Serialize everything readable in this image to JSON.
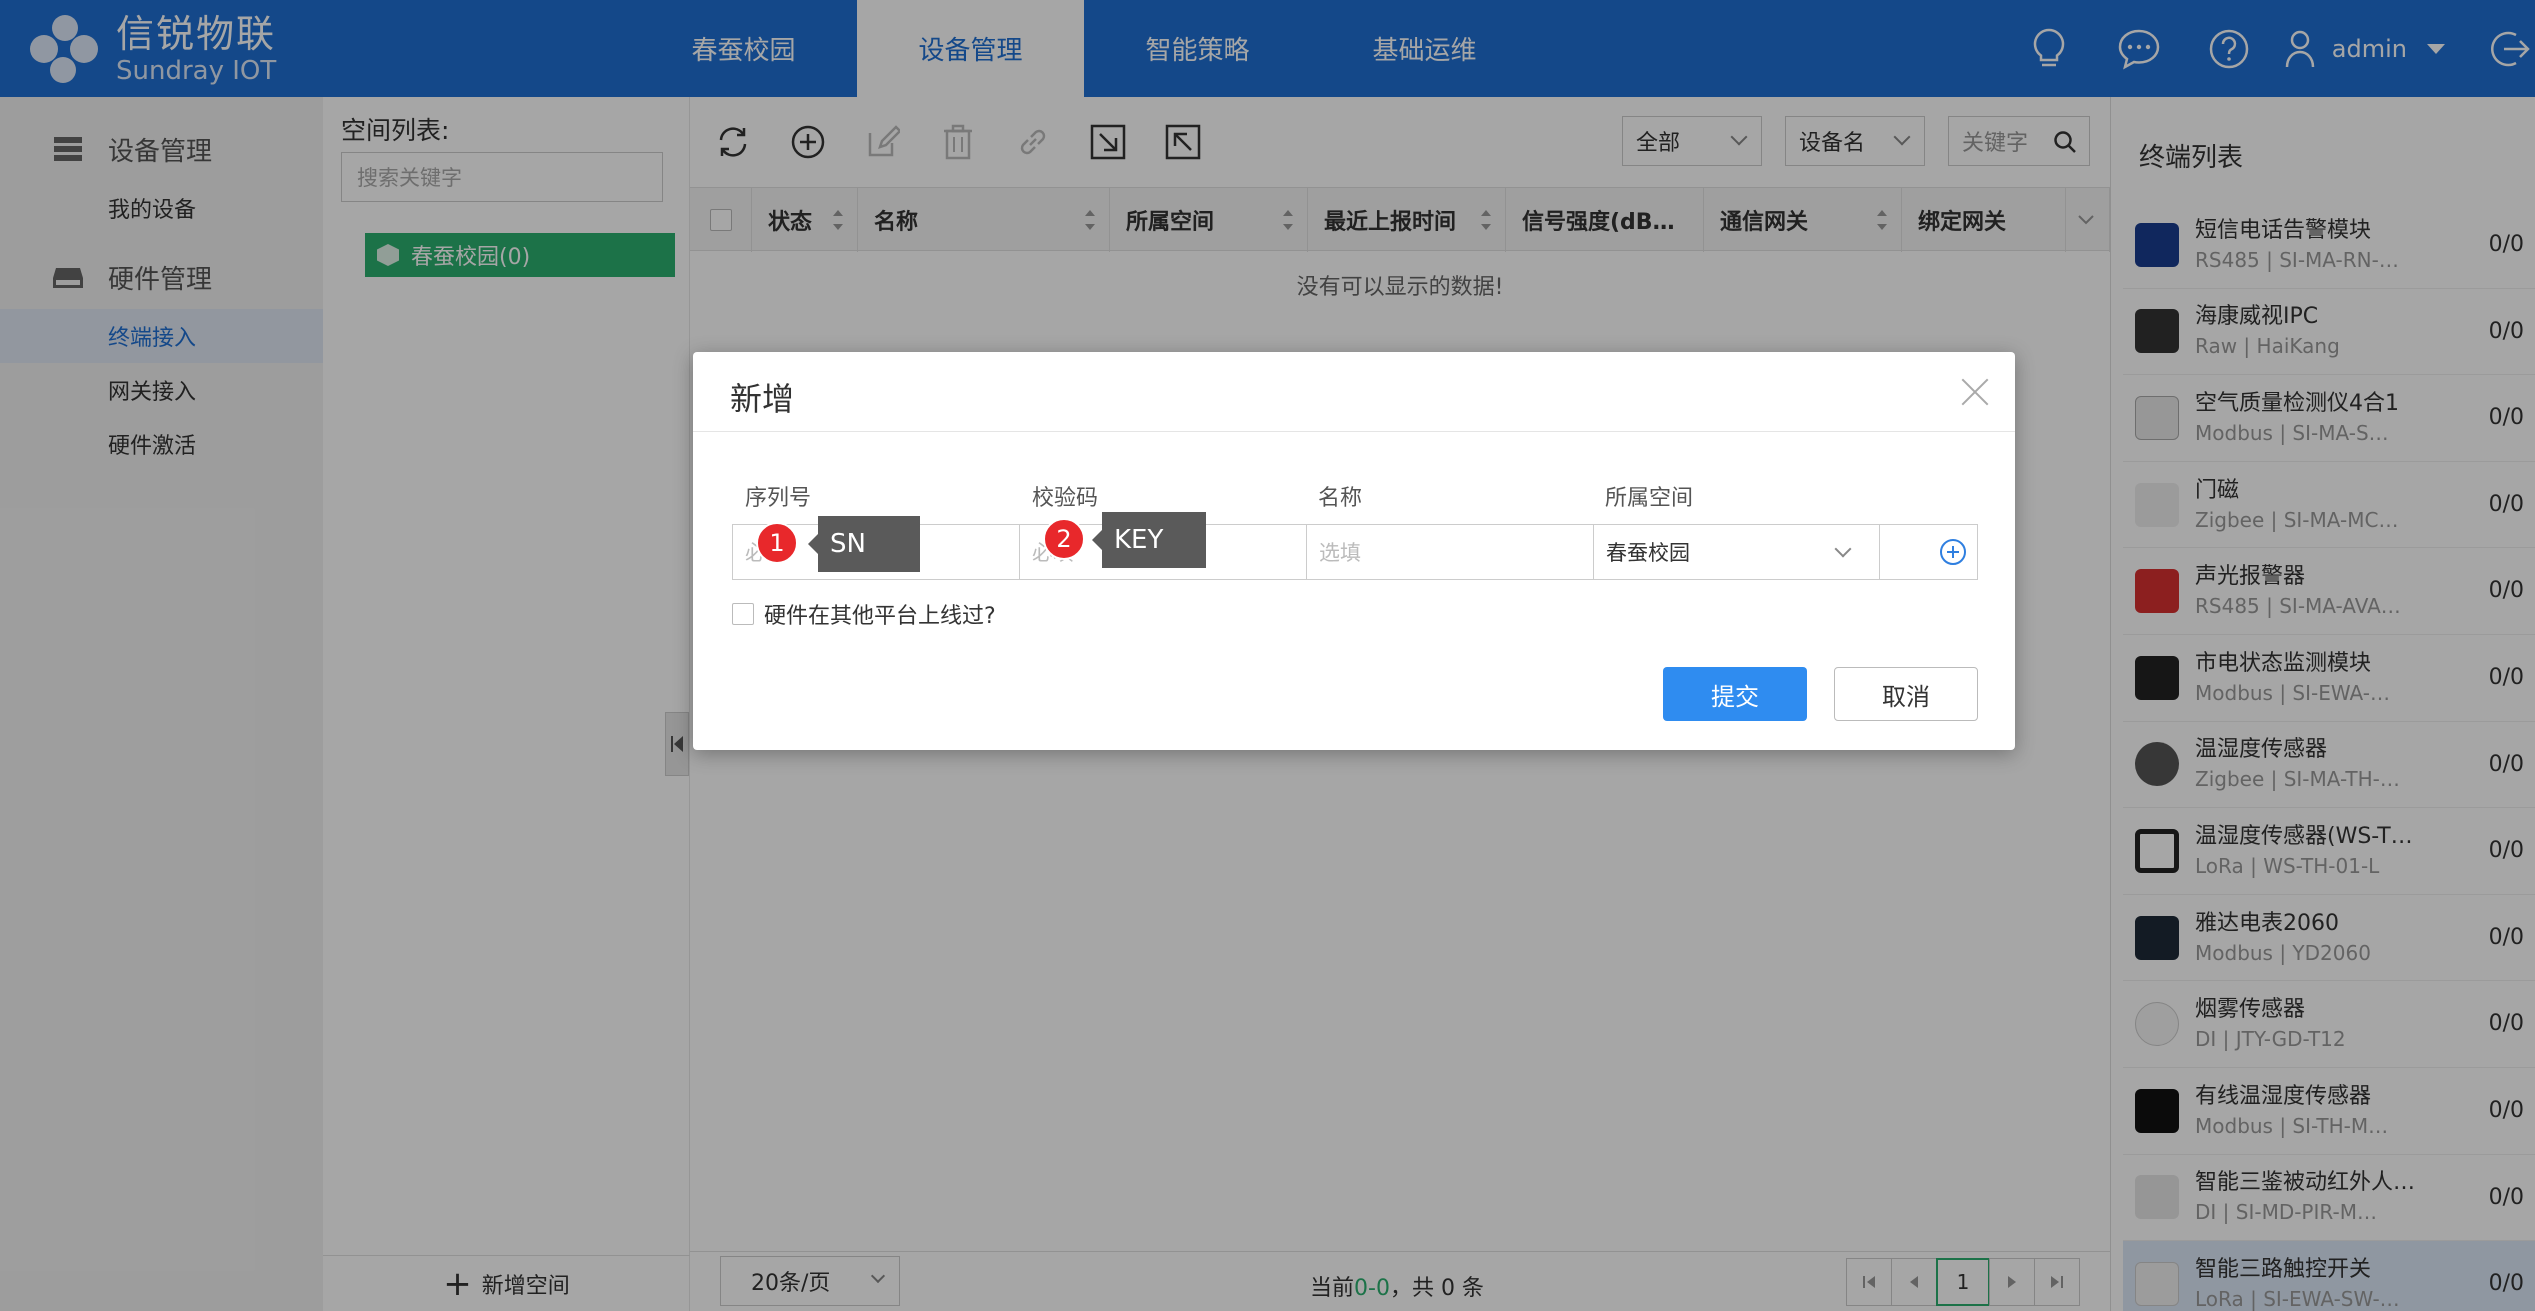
{
  "brand": {
    "name_cn": "信锐物联",
    "name_en": "Sundray IOT"
  },
  "nav": [
    "春蚕校园",
    "设备管理",
    "智能策略",
    "基础运维"
  ],
  "user": {
    "name": "admin"
  },
  "sidebar": {
    "group1": "设备管理",
    "group1_items": [
      "我的设备"
    ],
    "group2": "硬件管理",
    "group2_items": [
      "终端接入",
      "网关接入",
      "硬件激活"
    ]
  },
  "space": {
    "title": "空间列表:",
    "search_placeholder": "搜索关键字",
    "node": "春蚕校园(0)",
    "add_label": "新增空间"
  },
  "filters": {
    "scope": "全部",
    "field": "设备名",
    "keyword_placeholder": "关键字"
  },
  "table": {
    "columns": [
      "状态",
      "名称",
      "所属空间",
      "最近上报时间",
      "信号强度(dB…",
      "通信网关",
      "绑定网关"
    ],
    "empty": "没有可以显示的数据!"
  },
  "pager": {
    "page_size": "20条/页",
    "info_prefix": "当前",
    "range": "0-0",
    "info_suffix": "，共 0 条",
    "current_page": "1"
  },
  "terminal_list": {
    "title": "终端列表",
    "items": [
      {
        "name": "短信电话告警模块",
        "sub": "RS485 | SI-MA-RN-…",
        "count": "0/0"
      },
      {
        "name": "海康威视IPC",
        "sub": "Raw | HaiKang",
        "count": "0/0"
      },
      {
        "name": "空气质量检测仪4合1",
        "sub": "Modbus | SI-MA-S…",
        "count": "0/0"
      },
      {
        "name": "门磁",
        "sub": "Zigbee | SI-MA-MC…",
        "count": "0/0"
      },
      {
        "name": "声光报警器",
        "sub": "RS485 | SI-MA-AVA…",
        "count": "0/0"
      },
      {
        "name": "市电状态监测模块",
        "sub": "Modbus | SI-EWA-…",
        "count": "0/0"
      },
      {
        "name": "温湿度传感器",
        "sub": "Zigbee | SI-MA-TH-…",
        "count": "0/0"
      },
      {
        "name": "温湿度传感器(WS-T…",
        "sub": "LoRa | WS-TH-01-L",
        "count": "0/0"
      },
      {
        "name": "雅达电表2060",
        "sub": "Modbus | YD2060",
        "count": "0/0"
      },
      {
        "name": "烟雾传感器",
        "sub": "DI | JTY-GD-T12",
        "count": "0/0"
      },
      {
        "name": "有线温湿度传感器",
        "sub": "Modbus | SI-TH-M…",
        "count": "0/0"
      },
      {
        "name": "智能三鉴被动红外人…",
        "sub": "DI | SI-MD-PIR-M…",
        "count": "0/0"
      },
      {
        "name": "智能三路触控开关",
        "sub": "LoRa | SI-EWA-SW-…",
        "count": "0/0"
      }
    ]
  },
  "dialog": {
    "title": "新增",
    "labels": {
      "sn": "序列号",
      "key": "校验码",
      "name": "名称",
      "space": "所属空间"
    },
    "placeholders": {
      "sn": "必填",
      "key": "必填",
      "name": "选填"
    },
    "space_value": "春蚕校园",
    "checkbox_label": "硬件在其他平台上线过?",
    "submit": "提交",
    "cancel": "取消"
  },
  "annotations": [
    {
      "num": "1",
      "label": "SN"
    },
    {
      "num": "2",
      "label": "KEY"
    }
  ]
}
